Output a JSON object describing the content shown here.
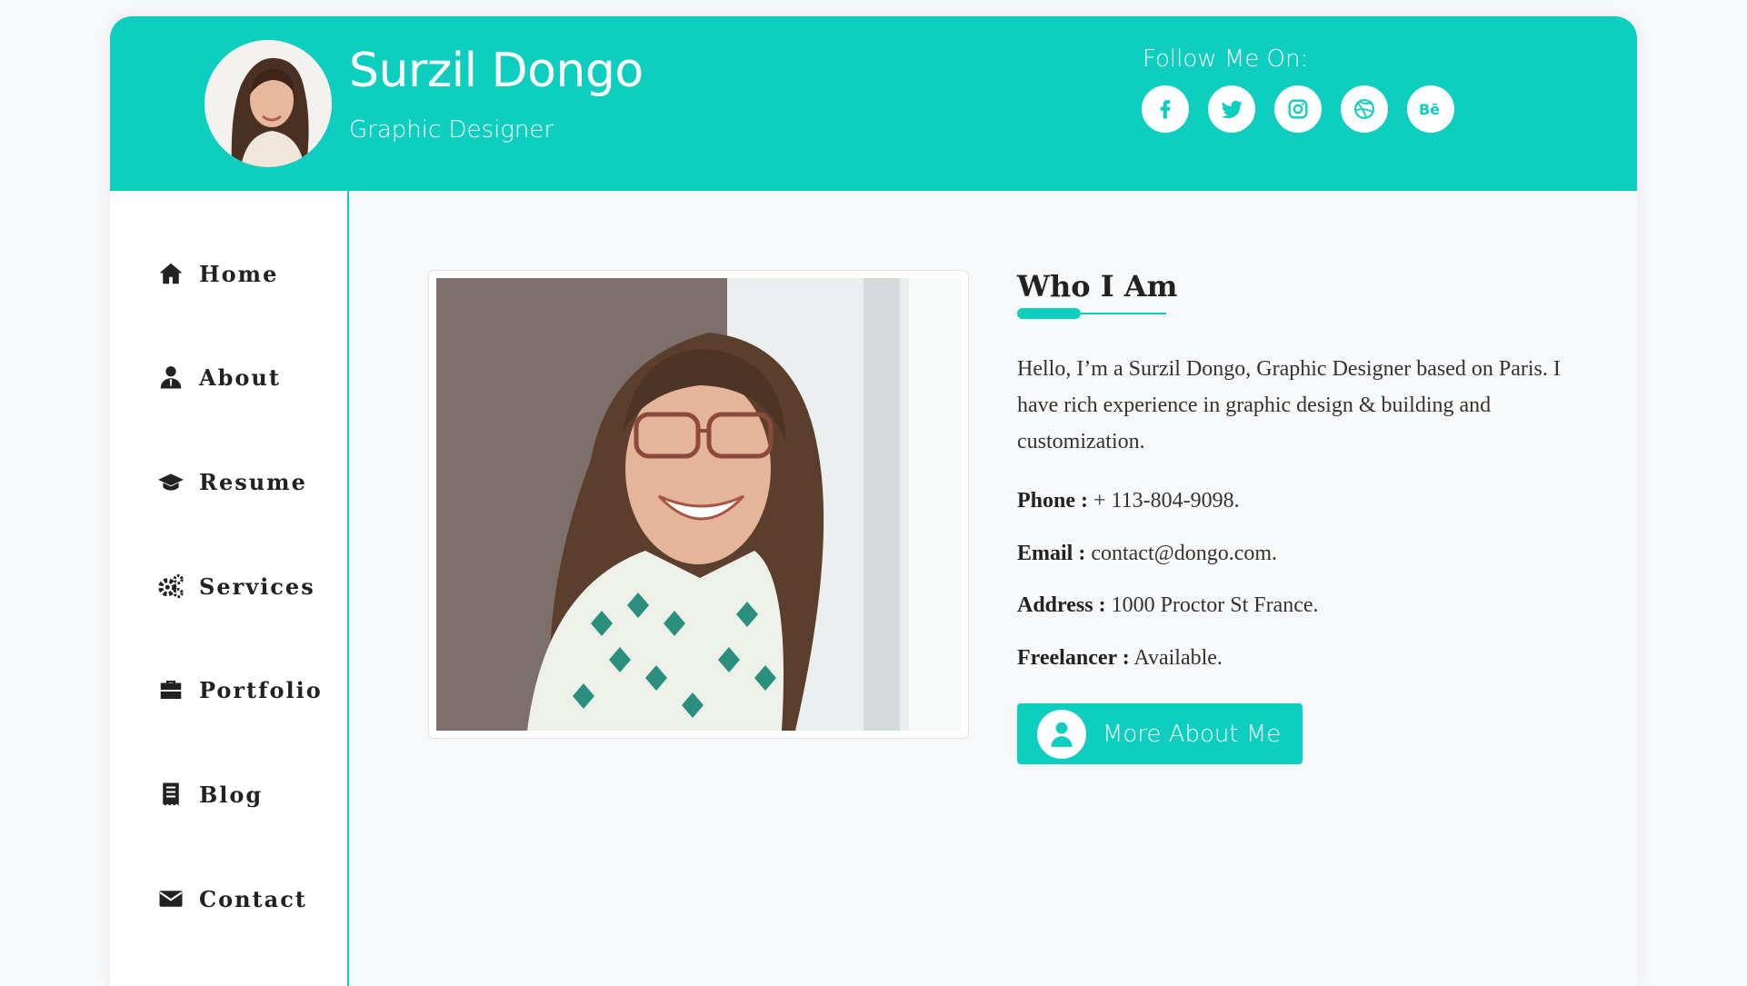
{
  "colors": {
    "accent": "#0ecec0",
    "text": "#222222",
    "background": "#f7f8fa"
  },
  "header": {
    "name": "Surzil Dongo",
    "role": "Graphic Designer",
    "follow_label": "Follow Me On:",
    "socials": [
      "facebook-icon",
      "twitter-icon",
      "instagram-icon",
      "dribbble-icon",
      "behance-icon"
    ]
  },
  "sidebar": {
    "items": [
      {
        "label": "Home",
        "icon": "home-icon"
      },
      {
        "label": "About",
        "icon": "user-icon"
      },
      {
        "label": "Resume",
        "icon": "graduation-cap-icon"
      },
      {
        "label": "Services",
        "icon": "gears-icon"
      },
      {
        "label": "Portfolio",
        "icon": "briefcase-icon"
      },
      {
        "label": "Blog",
        "icon": "receipt-icon"
      },
      {
        "label": "Contact",
        "icon": "envelope-icon"
      }
    ]
  },
  "about": {
    "heading": "Who I Am",
    "bio": "Hello, I’m a Surzil Dongo, Graphic Designer based on Paris. I have rich experience in graphic design & building and customization.",
    "phone_label": "Phone :",
    "phone": "+ 113-804-9098.",
    "email_label": "Email :",
    "email": "contact@dongo.com.",
    "address_label": "Address :",
    "address": "1000 Proctor St France.",
    "freelancer_label": "Freelancer :",
    "freelancer": "Available.",
    "button_label": "More About Me"
  }
}
